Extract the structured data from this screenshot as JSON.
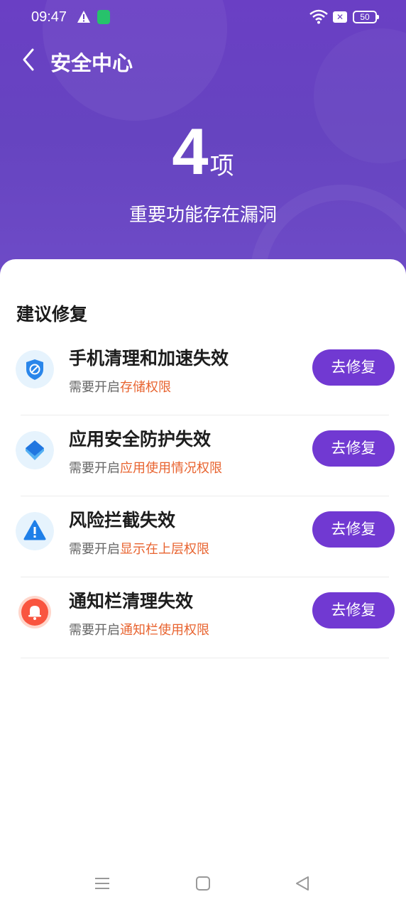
{
  "status_bar": {
    "time": "09:47",
    "battery": "50",
    "notification_icon": "x-icon"
  },
  "header": {
    "title": "安全中心"
  },
  "hero": {
    "count": "4",
    "unit": "项",
    "subtitle": "重要功能存在漏洞"
  },
  "section": {
    "title": "建议修复"
  },
  "items": [
    {
      "title": "手机清理和加速失效",
      "sub_prefix": "需要开启",
      "permission": "存储权限",
      "button": "去修复",
      "icon": "shield-icon"
    },
    {
      "title": "应用安全防护失效",
      "sub_prefix": "需要开启",
      "permission": "应用使用情况权限",
      "button": "去修复",
      "icon": "layers-icon"
    },
    {
      "title": "风险拦截失效",
      "sub_prefix": "需要开启",
      "permission": "显示在上层权限",
      "button": "去修复",
      "icon": "warning-triangle-icon"
    },
    {
      "title": "通知栏清理失效",
      "sub_prefix": "需要开启",
      "permission": "通知栏使用权限",
      "button": "去修复",
      "icon": "bell-icon"
    }
  ],
  "colors": {
    "accent": "#7139d2",
    "permission_text": "#e8632f",
    "hero_bg": "#6a3fc4"
  }
}
